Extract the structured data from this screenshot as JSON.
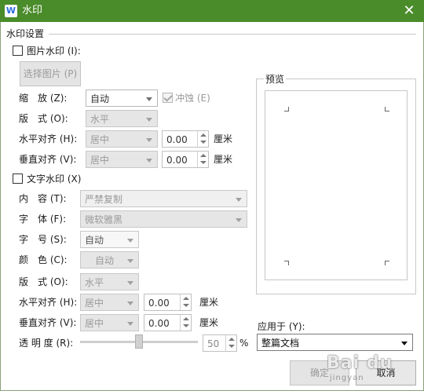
{
  "window": {
    "title": "水印",
    "app_icon": "W"
  },
  "group_title": "水印设置",
  "picture": {
    "checkbox_label": "图片水印 (I):",
    "select_button": "选择图片 (P)",
    "scale_label": "缩　放 (Z):",
    "scale_value": "自动",
    "erode_label": "冲蚀 (E)",
    "layout_label": "版　式 (O):",
    "layout_value": "水平",
    "h_align_label": "水平对齐 (H):",
    "h_align_value": "居中",
    "h_offset": "0.00",
    "v_align_label": "垂直对齐 (V):",
    "v_align_value": "居中",
    "v_offset": "0.00",
    "unit": "厘米"
  },
  "text": {
    "checkbox_label": "文字水印 (X)",
    "content_label": "内　容 (T):",
    "content_value": "严禁复制",
    "font_label": "字　体 (F):",
    "font_value": "微软雅黑",
    "size_label": "字　号 (S):",
    "size_value": "自动",
    "color_label": "颜　色 (C):",
    "color_value": "自动",
    "layout_label": "版　式 (O):",
    "layout_value": "水平",
    "h_align_label": "水平对齐 (H):",
    "h_align_value": "居中",
    "h_offset": "0.00",
    "v_align_label": "垂直对齐 (V):",
    "v_align_value": "居中",
    "v_offset": "0.00",
    "unit": "厘米",
    "transparency_label": "透 明 度 (R):",
    "transparency_value": "50",
    "percent": "%"
  },
  "preview": {
    "title": "预览"
  },
  "apply": {
    "label": "应用于 (Y):",
    "value": "整篇文档"
  },
  "buttons": {
    "ok": "确定",
    "cancel": "取消"
  },
  "overlay": {
    "watermark": "Bai du",
    "watermark_sub": "jingyan"
  },
  "transparency_fraction": 0.5,
  "colors": {
    "titlebar": "#4a8b2a",
    "frame": "#8aa07a"
  }
}
